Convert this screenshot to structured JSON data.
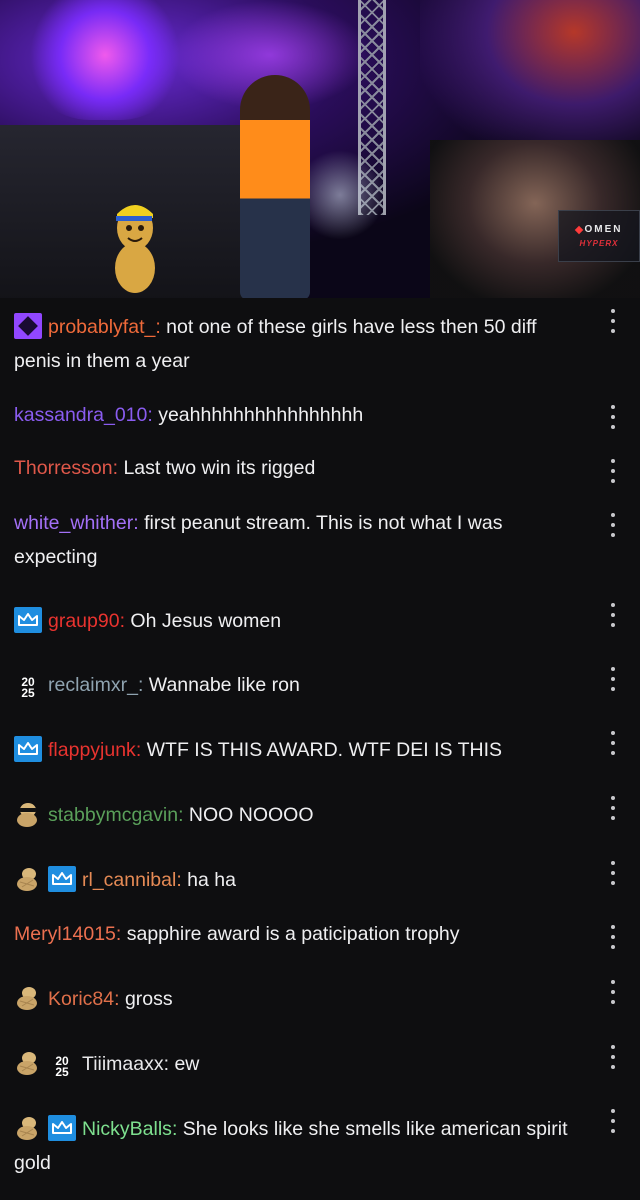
{
  "stream": {
    "overlay_brand": "OMEN",
    "overlay_sub": "HYPERX"
  },
  "chat": {
    "messages": [
      {
        "badges": [
          "diamond-icon"
        ],
        "user": "probablyfat_",
        "user_color": "#ef6a3a",
        "separator": ":",
        "text": " not one of these girls have less then 50 diff penis in them a year"
      },
      {
        "badges": [],
        "user": "kassandra_010",
        "user_color": "#8a5cf0",
        "separator": ":",
        "text": " yeahhhhhhhhhhhhhhhh"
      },
      {
        "badges": [],
        "user": "Thorresson",
        "user_color": "#e0584a",
        "separator": ":",
        "text": " Last two win its rigged"
      },
      {
        "badges": [],
        "user": "white_whither",
        "user_color": "#a370f7",
        "separator": ":",
        "text": " first peanut stream. This is not what I was expecting"
      },
      {
        "badges": [
          "crown-icon"
        ],
        "user": "graup90",
        "user_color": "#e8332f",
        "separator": ":",
        "text": " Oh Jesus women"
      },
      {
        "badges": [
          "2025-icon"
        ],
        "user": "reclaimxr_",
        "user_color": "#8fa3b0",
        "separator": ":",
        "text": " Wannabe like ron"
      },
      {
        "badges": [
          "crown-icon"
        ],
        "user": "flappyjunk",
        "user_color": "#e8332f",
        "separator": ":",
        "text": " WTF IS THIS AWARD. WTF DEI IS THIS"
      },
      {
        "badges": [
          "peanut-sunglasses-icon"
        ],
        "user": "stabbymcgavin",
        "user_color": "#5aa05a",
        "separator": ":",
        "text": " NOO NOOOO"
      },
      {
        "badges": [
          "peanut-icon",
          "crown-icon"
        ],
        "user": "rl_cannibal",
        "user_color": "#e58a55",
        "separator": ":",
        "text": " ha ha"
      },
      {
        "badges": [],
        "user": "Meryl14015",
        "user_color": "#ec7050",
        "separator": ":",
        "text": " sapphire award is a paticipation trophy"
      },
      {
        "badges": [
          "peanut-icon"
        ],
        "user": "Koric84",
        "user_color": "#e0704a",
        "separator": ":",
        "text": " gross"
      },
      {
        "badges": [
          "peanut-icon",
          "2025-icon"
        ],
        "user": "Tiiimaaxx",
        "user_color": "#e8e8ea",
        "separator": ":",
        "text": " ew"
      },
      {
        "badges": [
          "peanut-icon",
          "crown-icon"
        ],
        "user": "NickyBalls",
        "user_color": "#7ee08f",
        "separator": ":",
        "text": " She looks like she smells like american spirit gold"
      }
    ],
    "badge_2025_text": {
      "top": "20",
      "bottom": "25"
    }
  }
}
